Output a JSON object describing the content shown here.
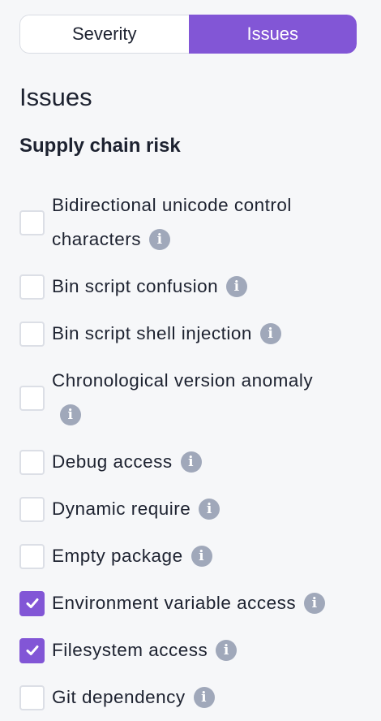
{
  "toggle": {
    "severity_label": "Severity",
    "issues_label": "Issues",
    "active": "Issues"
  },
  "section_title": "Issues",
  "group_title": "Supply chain risk",
  "colors": {
    "accent": "#8256d6",
    "info_icon": "#a0a8ba",
    "text": "#1d2230",
    "background": "#f6f7f9"
  },
  "issues": [
    {
      "label": "Bidirectional unicode control characters",
      "checked": false
    },
    {
      "label": "Bin script confusion",
      "checked": false
    },
    {
      "label": "Bin script shell injection",
      "checked": false
    },
    {
      "label": "Chronological version anomaly",
      "checked": false
    },
    {
      "label": "Debug access",
      "checked": false
    },
    {
      "label": "Dynamic require",
      "checked": false
    },
    {
      "label": "Empty package",
      "checked": false
    },
    {
      "label": "Environment variable access",
      "checked": true
    },
    {
      "label": "Filesystem access",
      "checked": true
    },
    {
      "label": "Git dependency",
      "checked": false
    }
  ],
  "info_icon_glyph": "i"
}
